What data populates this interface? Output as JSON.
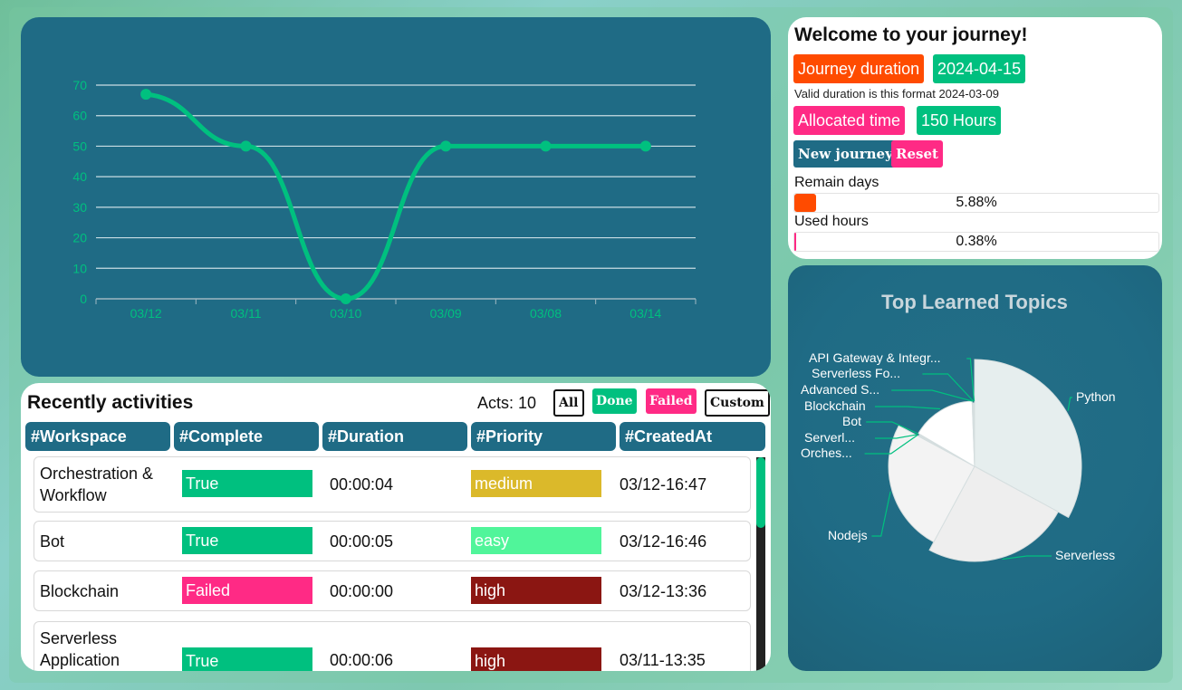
{
  "colors": {
    "teal_panel": "#1f6b85",
    "green": "#00c07f",
    "orange": "#ff4b00",
    "pink": "#ff2a85",
    "medium": "#dbb92a",
    "easy": "#50f59a",
    "high": "#8b1612"
  },
  "line_chart": {
    "chart_data": {
      "type": "line",
      "categories": [
        "03/12",
        "03/11",
        "03/10",
        "03/09",
        "03/08",
        "03/14"
      ],
      "values": [
        67,
        50,
        0,
        50,
        50,
        50
      ],
      "ylim": [
        0,
        70
      ],
      "yticks": [
        "0",
        "10",
        "20",
        "30",
        "40",
        "50",
        "60",
        "70"
      ],
      "grid": true,
      "title": "",
      "xlabel": "",
      "ylabel": ""
    }
  },
  "journey": {
    "title": "Welcome to your journey!",
    "duration_label": "Journey duration",
    "duration_value": "2024-04-15",
    "hint": "Valid duration is this format 2024-03-09",
    "allocated_label": "Allocated time",
    "allocated_value": "150 Hours",
    "new_button": "New journey",
    "reset_button": "Reset",
    "remain_label": "Remain days",
    "remain_value": "5.88%",
    "remain_fraction": 0.0588,
    "used_label": "Used hours",
    "used_value": "0.38%",
    "used_fraction": 0.0038
  },
  "pie": {
    "chart_data": {
      "type": "pie",
      "title": "Top Learned Topics",
      "labels": [
        "Python",
        "Serverless",
        "Nodejs",
        "Orches...",
        "Serverl...",
        "Bot",
        "Blockchain",
        "Advanced S...",
        "Serverless Fo...",
        "API Gateway & Integr..."
      ],
      "values": [
        33,
        25,
        25,
        0.2,
        0.2,
        0.2,
        16,
        0.2,
        0.2,
        0.2
      ]
    }
  },
  "activities": {
    "title": "Recently activities",
    "acts": "Acts: 10",
    "filters": [
      "All",
      "Done",
      "Failed",
      "Custom"
    ],
    "headers": [
      "#Workspace",
      "#Complete",
      "#Duration",
      "#Priority",
      "#CreatedAt"
    ],
    "rows": [
      {
        "workspace": [
          "Orchestration &",
          "Workflow"
        ],
        "complete": "True",
        "duration": "00:00:04",
        "priority": "medium",
        "created": "03/12-16:47"
      },
      {
        "workspace": [
          "Bot"
        ],
        "complete": "True",
        "duration": "00:00:05",
        "priority": "easy",
        "created": "03/12-16:46"
      },
      {
        "workspace": [
          "Blockchain"
        ],
        "complete": "Failed",
        "duration": "00:00:00",
        "priority": "high",
        "created": "03/12-13:36"
      },
      {
        "workspace": [
          "Serverless",
          "Application"
        ],
        "complete": "True",
        "duration": "00:00:06",
        "priority": "high",
        "created": "03/11-13:35"
      }
    ]
  }
}
